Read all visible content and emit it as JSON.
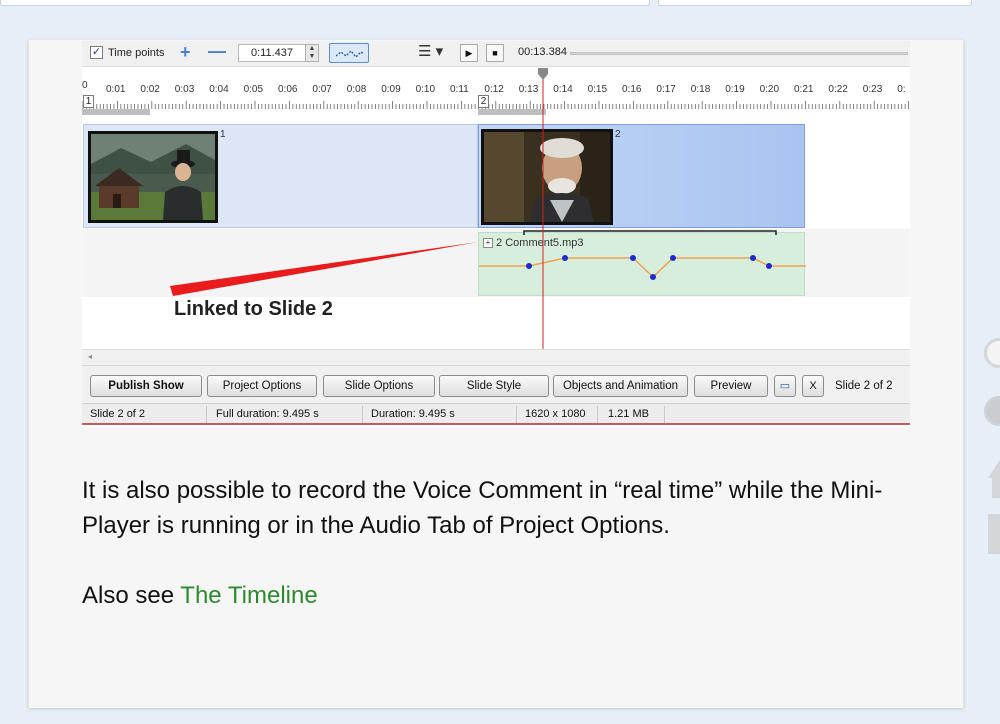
{
  "toolbar": {
    "time_points_label": "Time points",
    "time_points_checked": true,
    "current_time": "0:11.437",
    "position_time": "00:13.384"
  },
  "ruler": {
    "zero_label": "0",
    "tick_labels": [
      "0:01",
      "0:02",
      "0:03",
      "0:04",
      "0:05",
      "0:06",
      "0:07",
      "0:08",
      "0:09",
      "0:10",
      "0:11",
      "0:12",
      "0:13",
      "0:14",
      "0:15",
      "0:16",
      "0:17",
      "0:18",
      "0:19",
      "0:20",
      "0:21",
      "0:22",
      "0:23",
      "0:"
    ],
    "slide_markers": [
      "1",
      "2"
    ]
  },
  "slides": [
    {
      "number": "1"
    },
    {
      "number": "2"
    }
  ],
  "audio": {
    "name": "2  Comment5.mp3"
  },
  "annotation": {
    "text": "Linked to Slide 2",
    "arrow_color": "#e81c1c"
  },
  "buttons": {
    "publish_show": "Publish Show",
    "project_options": "Project Options",
    "slide_options": "Slide Options",
    "slide_style": "Slide Style",
    "objects_and_animation": "Objects and Animation",
    "preview": "Preview",
    "close": "X",
    "slide_count": "Slide 2 of 2"
  },
  "status": {
    "slide": "Slide 2 of 2",
    "full_duration": "Full duration: 9.495 s",
    "duration": "Duration: 9.495 s",
    "resolution": "1620 x 1080",
    "size": "1.21 MB"
  },
  "article": {
    "paragraph": "It is also possible to record the Voice Comment in “real time” while the Mini-Player is running or in the Audio Tab of Project Options.",
    "also_see_prefix": "Also see ",
    "also_see_link": "The Timeline",
    "link_color": "#2c8a2c"
  }
}
